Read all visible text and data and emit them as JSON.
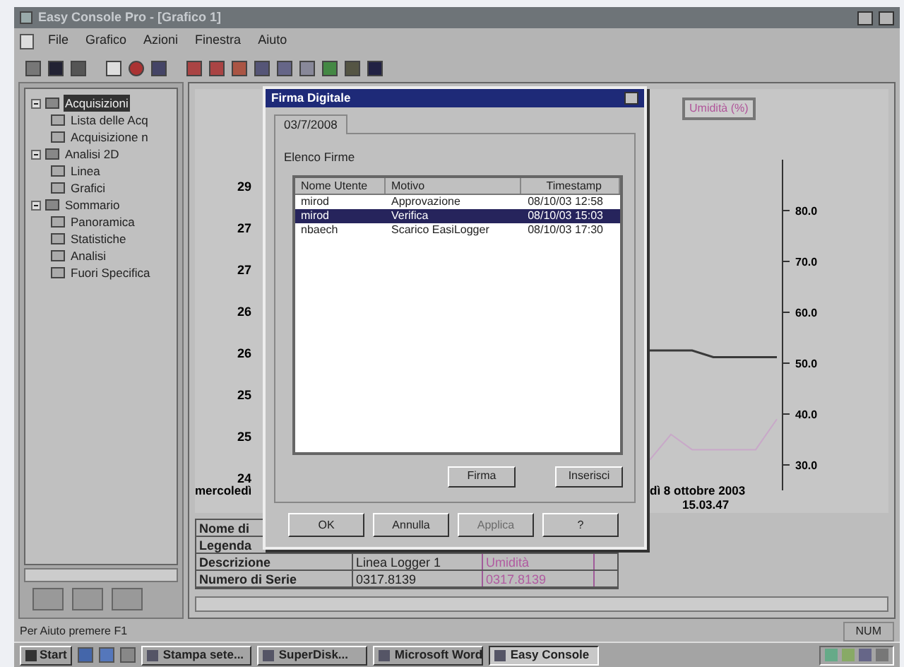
{
  "window": {
    "title": "Easy Console Pro - [Grafico 1]"
  },
  "menu": [
    "File",
    "Grafico",
    "Azioni",
    "Finestra",
    "Aiuto"
  ],
  "tree": [
    {
      "label": "Acquisizioni",
      "expanded": true,
      "selected": true,
      "children": [
        {
          "label": "Lista delle Acq",
          "selected": false
        },
        {
          "label": "Acquisizione n",
          "selected": false
        }
      ]
    },
    {
      "label": "Analisi 2D",
      "expanded": true,
      "selected": false,
      "children": [
        {
          "label": "Linea",
          "selected": false
        },
        {
          "label": "Grafici",
          "selected": false
        }
      ]
    },
    {
      "label": "Sommario",
      "expanded": true,
      "selected": false,
      "children": [
        {
          "label": "Panoramica",
          "selected": false
        },
        {
          "label": "Statistiche",
          "selected": false
        },
        {
          "label": "Analisi",
          "selected": false
        },
        {
          "label": "Fuori Specifica",
          "selected": false
        }
      ]
    }
  ],
  "chart": {
    "left_axis_labels": [
      "29",
      "27",
      "27",
      "26",
      "26",
      "25",
      "25",
      "24"
    ],
    "left_caption": "mercoledì",
    "right_caption": "dì 8 ottobre 2003",
    "time_caption": "15.03.47",
    "chart_data": {
      "type": "line",
      "ylim": [
        25,
        90
      ],
      "yticks": [
        {
          "value": 80,
          "label": "80.0"
        },
        {
          "value": 70,
          "label": "70.0"
        },
        {
          "value": 60,
          "label": "60.0"
        },
        {
          "value": 50,
          "label": "50.0"
        },
        {
          "value": 40,
          "label": "40.0"
        },
        {
          "value": 30,
          "label": "30.0"
        }
      ],
      "series": [
        {
          "name": "Umidità (%)",
          "color": "#3a3a3a",
          "values": [
            52.5,
            52.5,
            52.5,
            51.2,
            51.2,
            51.2,
            51.2
          ]
        },
        {
          "color": "#c8a8c8",
          "values": [
            31,
            36,
            33,
            33,
            33,
            33,
            39
          ]
        }
      ]
    }
  },
  "info_table": [
    {
      "label": "Nome di"
    },
    {
      "label": "Legenda"
    },
    {
      "label": "Descrizione",
      "value": "Linea Logger 1",
      "extra": "Umidità"
    },
    {
      "label": "Numero di Serie",
      "value": "0317.8139",
      "extra": "0317.8139"
    }
  ],
  "dialog": {
    "title": "Firma Digitale",
    "tabs": [
      {
        "label": "03/7/2008",
        "selected": true
      }
    ],
    "group": "Elenco Firme",
    "columns": [
      "Nome Utente",
      "Motivo",
      "Timestamp"
    ],
    "rows": [
      {
        "cells": [
          "mirod",
          "Approvazione",
          "08/10/03 12:58"
        ],
        "selected": false
      },
      {
        "cells": [
          "mirod",
          "Verifica",
          "08/10/03 15:03"
        ],
        "selected": true
      },
      {
        "cells": [
          "nbaech",
          "Scarico EasiLogger",
          "08/10/03 17:30"
        ],
        "selected": false
      }
    ],
    "list_buttons": [
      "Firma",
      "Inserisci"
    ],
    "buttons": [
      {
        "label": "OK",
        "disabled": false
      },
      {
        "label": "Annulla",
        "disabled": false
      },
      {
        "label": "Applica",
        "disabled": true
      },
      {
        "label": "?",
        "disabled": false
      }
    ]
  },
  "status_bar": {
    "message": "Per Aiuto premere F1",
    "indicator": "NUM"
  },
  "taskbar": {
    "start": "Start",
    "tasks": [
      {
        "label": "Stampa sete...",
        "selected": false
      },
      {
        "label": "SuperDisk...",
        "selected": false
      },
      {
        "label": "Microsoft Word",
        "selected": false
      },
      {
        "label": "Easy Console",
        "selected": true
      }
    ]
  }
}
